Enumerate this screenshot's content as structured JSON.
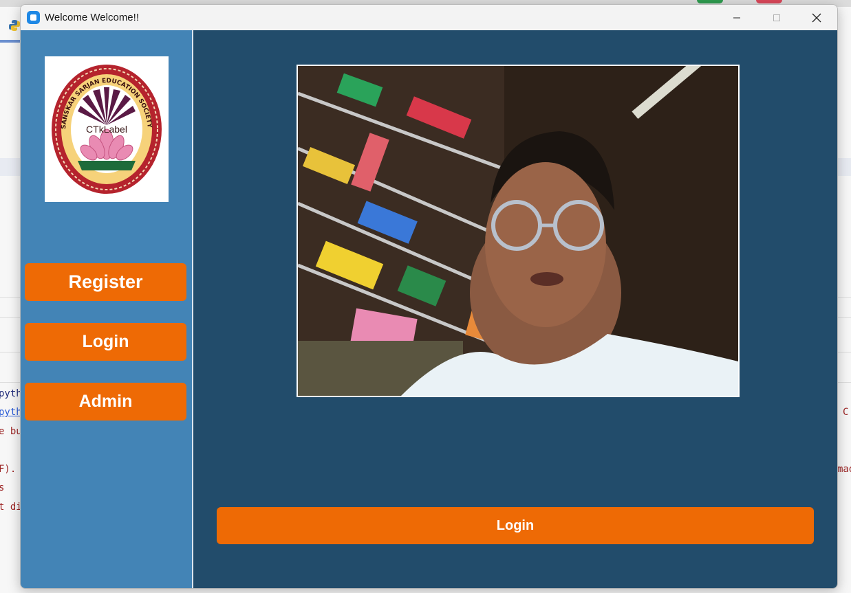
{
  "window": {
    "title": "Welcome Welcome!!"
  },
  "sidebar": {
    "logo_label": "CTkLabel",
    "logo_seal_text": "SANSKAR SARJAN EDUCATION SOCIETY",
    "buttons": {
      "register": "Register",
      "login": "Login",
      "admin": "Admin"
    }
  },
  "main": {
    "login_button": "Login"
  },
  "background_code": [
    {
      "text": "pyth"
    },
    {
      "text": "pyth"
    },
    {
      "text": "e bu"
    },
    {
      "text": "F)."
    },
    {
      "text": "s"
    },
    {
      "text": "t di"
    },
    {
      "text": "C"
    },
    {
      "text": "mad"
    }
  ],
  "colors": {
    "sidebar": "#4384b6",
    "main_bg": "#224c6b",
    "button": "#ee6a05",
    "button_text": "#ffffff"
  }
}
